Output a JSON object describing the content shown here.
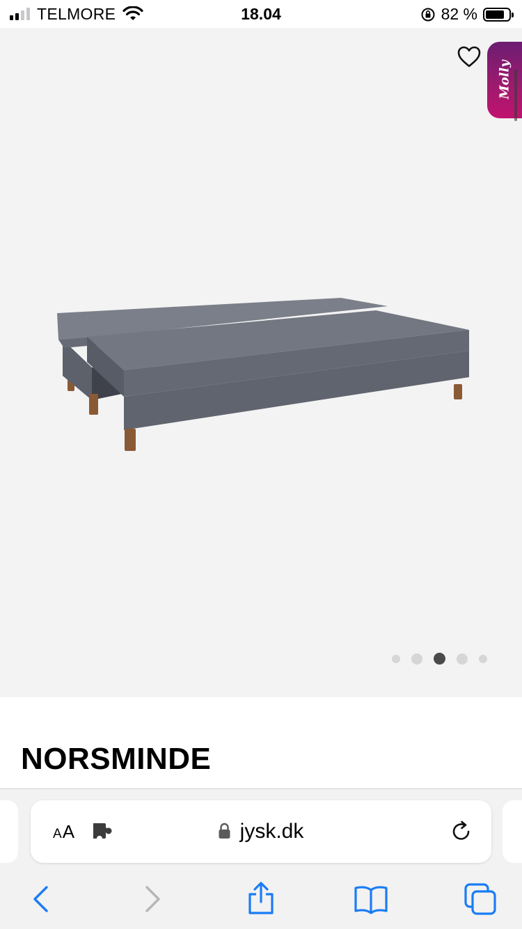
{
  "status_bar": {
    "carrier": "TELMORE",
    "time": "18.04",
    "battery_percent": "82 %",
    "battery_level": 0.82
  },
  "gallery": {
    "favorite_icon": "heart-outline-icon",
    "assistant_badge": "Molly",
    "image": "grey sofa bed unfolded",
    "page_count": 5,
    "active_page": 3
  },
  "product": {
    "title": "NORSMINDE"
  },
  "browser": {
    "text_size_label": "AA",
    "url": "jysk.dk",
    "icons": [
      "back-icon",
      "forward-icon",
      "share-icon",
      "bookmarks-icon",
      "tabs-icon",
      "reload-icon",
      "lock-icon",
      "extension-icon"
    ]
  },
  "colors": {
    "ios_blue": "#1a7cf5",
    "disabled": "#b5b5ba",
    "gallery_bg": "#f3f3f3",
    "sofa": "#6e7280"
  }
}
